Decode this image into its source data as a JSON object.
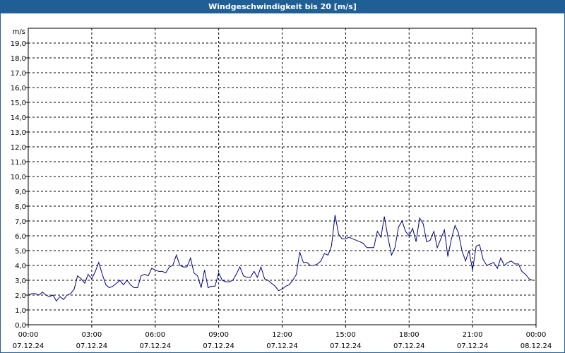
{
  "title": "Windgeschwindigkeit bis 20 [m/s]",
  "chart_data": {
    "type": "line",
    "title": "Windgeschwindigkeit bis 20 [m/s]",
    "ylabel": "m/s",
    "ylim": [
      0,
      20
    ],
    "grid": true,
    "y_ticks": [
      "0,0",
      "1,0",
      "2,0",
      "3,0",
      "4,0",
      "5,0",
      "6,0",
      "7,0",
      "8,0",
      "9,0",
      "10,0",
      "11,0",
      "12,0",
      "13,0",
      "14,0",
      "15,0",
      "16,0",
      "17,0",
      "18,0",
      "19,0"
    ],
    "x_ticks": [
      {
        "hour": 0,
        "time": "00:00",
        "date": "07.12.24"
      },
      {
        "hour": 3,
        "time": "03:00",
        "date": "07.12.24"
      },
      {
        "hour": 6,
        "time": "06:00",
        "date": "07.12.24"
      },
      {
        "hour": 9,
        "time": "09:00",
        "date": "07.12.24"
      },
      {
        "hour": 12,
        "time": "12:00",
        "date": "07.12.24"
      },
      {
        "hour": 15,
        "time": "15:00",
        "date": "07.12.24"
      },
      {
        "hour": 18,
        "time": "18:00",
        "date": "07.12.24"
      },
      {
        "hour": 21,
        "time": "21:00",
        "date": "07.12.24"
      },
      {
        "hour": 24,
        "time": "00:00",
        "date": "08.12.24"
      }
    ],
    "xlim": [
      0,
      24
    ],
    "series": [
      {
        "color": "#00008b",
        "x": [
          0.0,
          0.17,
          0.33,
          0.5,
          0.67,
          0.83,
          1.0,
          1.17,
          1.33,
          1.5,
          1.67,
          1.83,
          2.0,
          2.17,
          2.33,
          2.5,
          2.67,
          2.83,
          3.0,
          3.17,
          3.33,
          3.5,
          3.67,
          3.83,
          4.0,
          4.17,
          4.33,
          4.5,
          4.67,
          4.83,
          5.0,
          5.17,
          5.33,
          5.5,
          5.67,
          5.83,
          6.0,
          6.17,
          6.33,
          6.5,
          6.67,
          6.83,
          7.0,
          7.17,
          7.33,
          7.5,
          7.67,
          7.83,
          8.0,
          8.17,
          8.33,
          8.5,
          8.67,
          8.83,
          9.0,
          9.17,
          9.33,
          9.5,
          9.67,
          9.83,
          10.0,
          10.17,
          10.33,
          10.5,
          10.67,
          10.83,
          11.0,
          11.17,
          11.33,
          11.5,
          11.67,
          11.83,
          12.0,
          12.17,
          12.33,
          12.5,
          12.67,
          12.83,
          13.0,
          13.17,
          13.33,
          13.5,
          13.67,
          13.83,
          14.0,
          14.17,
          14.33,
          14.5,
          14.67,
          14.83,
          15.0,
          15.17,
          15.33,
          15.5,
          15.67,
          15.83,
          16.0,
          16.17,
          16.33,
          16.5,
          16.67,
          16.83,
          17.0,
          17.17,
          17.33,
          17.5,
          17.67,
          17.83,
          18.0,
          18.17,
          18.33,
          18.5,
          18.67,
          18.83,
          19.0,
          19.17,
          19.33,
          19.5,
          19.67,
          19.83,
          20.0,
          20.17,
          20.33,
          20.5,
          20.67,
          20.83,
          21.0,
          21.17,
          21.33,
          21.5,
          21.67,
          21.83,
          22.0,
          22.17,
          22.33,
          22.5,
          22.67,
          22.83,
          23.0,
          23.17,
          23.33,
          23.5,
          23.67,
          23.83
        ],
        "values": [
          2.0,
          2.1,
          2.1,
          2.0,
          2.2,
          2.0,
          1.9,
          2.0,
          1.6,
          1.9,
          1.7,
          2.0,
          2.1,
          2.4,
          3.3,
          3.1,
          2.8,
          3.4,
          3.1,
          3.6,
          4.2,
          3.4,
          2.7,
          2.5,
          2.6,
          2.8,
          3.0,
          2.7,
          3.0,
          2.7,
          2.5,
          2.5,
          3.3,
          3.4,
          3.3,
          3.8,
          3.7,
          3.6,
          3.6,
          3.5,
          3.9,
          4.0,
          4.7,
          4.0,
          3.9,
          3.9,
          4.5,
          3.5,
          3.3,
          2.5,
          3.7,
          2.5,
          2.6,
          2.6,
          3.5,
          3.0,
          2.9,
          2.9,
          3.0,
          3.4,
          3.9,
          3.3,
          3.2,
          3.2,
          3.6,
          3.2,
          3.9,
          3.1,
          3.0,
          2.8,
          2.6,
          2.3,
          2.4,
          2.6,
          2.7,
          3.0,
          3.4,
          4.9,
          4.2,
          4.2,
          4.0,
          4.0,
          4.1,
          4.3,
          4.8,
          4.7,
          5.3,
          7.4,
          6.1,
          5.8,
          5.8,
          5.9,
          5.8,
          5.7,
          5.6,
          5.5,
          5.2,
          5.2,
          5.2,
          6.3,
          5.9,
          7.3,
          5.9,
          4.7,
          5.2,
          6.6,
          7.0,
          6.3,
          6.0,
          6.5,
          5.6,
          7.2,
          6.8,
          5.6,
          5.7,
          6.3,
          5.2,
          5.8,
          6.4,
          4.6,
          5.8,
          6.7,
          6.2,
          5.0,
          4.3,
          5.0,
          3.7,
          5.3,
          5.4,
          4.4,
          4.0,
          4.1,
          4.2,
          3.8,
          4.5,
          4.0,
          4.2,
          4.3,
          4.1,
          4.1,
          3.6,
          3.4,
          3.1,
          3.0
        ]
      }
    ]
  }
}
